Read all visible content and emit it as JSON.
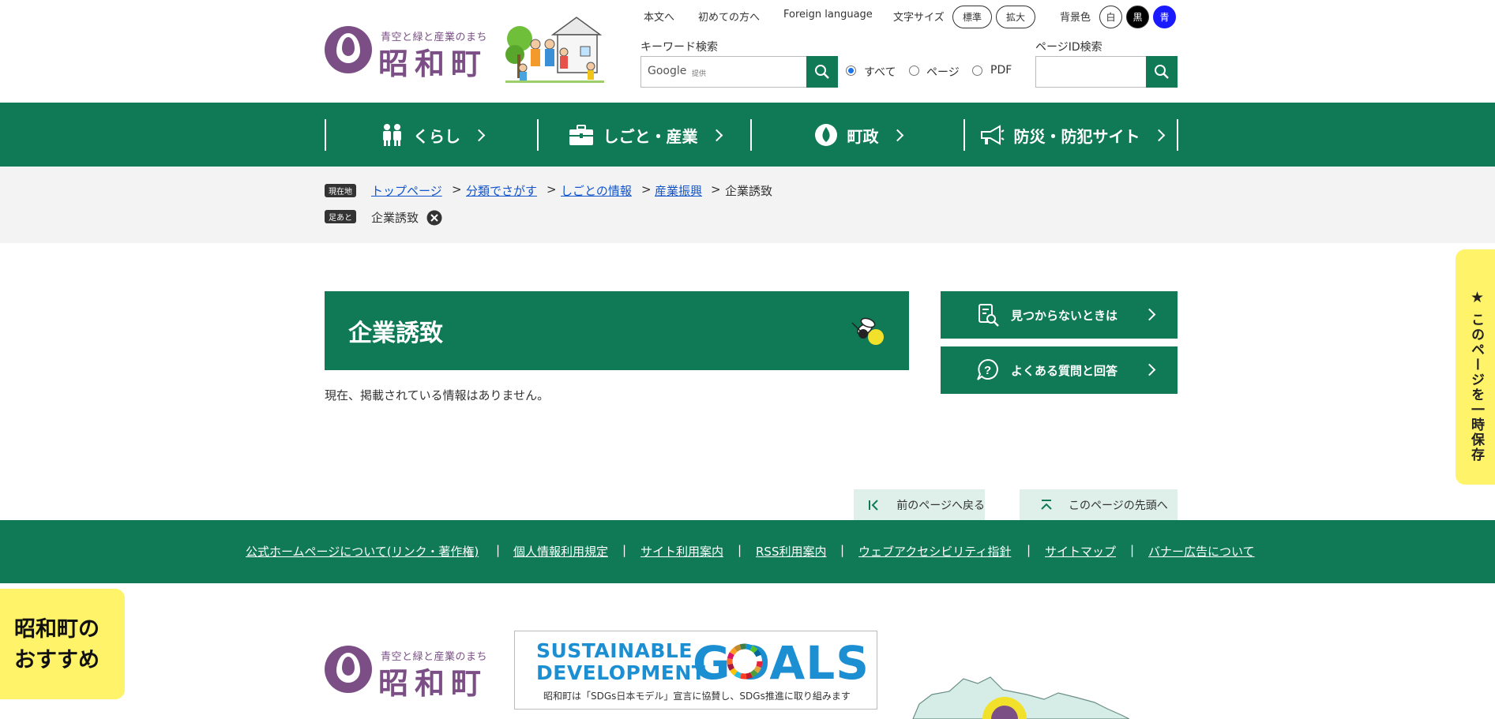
{
  "header": {
    "logo_tagline": "青空と緑と産業のまち",
    "logo_name": "昭和町",
    "util_links": [
      "本文へ",
      "初めての方へ",
      "Foreign language"
    ],
    "font_size_label": "文字サイズ",
    "font_size_standard": "標準",
    "font_size_large": "拡大",
    "bg_color_label": "背景色",
    "bg_white": "白",
    "bg_black": "黒",
    "bg_blue": "青",
    "keyword_search_label": "キーワード検索",
    "google_label": "Google",
    "google_provided": "提供",
    "radio_all": "すべて",
    "radio_page": "ページ",
    "radio_pdf": "PDF",
    "page_id_search_label": "ページID検索"
  },
  "nav": {
    "items": [
      "くらし",
      "しごと・産業",
      "町政",
      "防災・防犯サイト"
    ]
  },
  "breadcrumb": {
    "current_tag": "現在地",
    "history_tag": "足あと",
    "links": [
      "トップページ",
      "分類でさがす",
      "しごとの情報",
      "産業振興"
    ],
    "current": "企業誘致",
    "history_item": "企業誘致",
    "separator": ">"
  },
  "main": {
    "title": "企業誘致",
    "empty_message": "現在、掲載されている情報はありません。"
  },
  "sidebar": {
    "not_found_label": "見つからないときは",
    "faq_label": "よくある質問と回答"
  },
  "page_nav": {
    "back_label": "前のページへ戻る",
    "top_label": "このページの先頭へ"
  },
  "footer": {
    "links": [
      "公式ホームページについて(リンク・著作権)",
      "個人情報利用規定",
      "サイト利用案内",
      "RSS利用案内",
      "ウェブアクセシビリティ指針",
      "サイトマップ",
      "バナー広告について"
    ],
    "separator": "|",
    "sdg_line1": "SUSTAINABLE",
    "sdg_line2": "DEVELOPMENT",
    "sdg_goals": "GOALS",
    "sdg_caption": "昭和町は「SDGs日本モデル」宣言に協賛し、SDGs推進に取り組みます"
  },
  "floating": {
    "save_tab": "このページを一時保存",
    "save_star": "★",
    "recommend_line1": "昭和町の",
    "recommend_line2": "おすすめ"
  },
  "colors": {
    "brand_green": "#0f7a55",
    "logo_purple": "#7b4f86",
    "accent_yellow": "#fff36a",
    "link_blue": "#1155cc",
    "sdg_blue": "#1b8fd1"
  }
}
